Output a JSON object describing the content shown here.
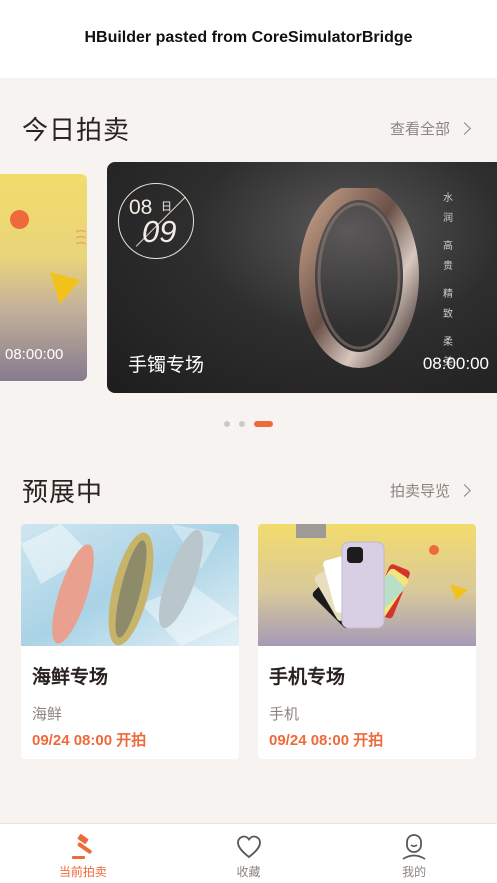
{
  "toast": {
    "text": "HBuilder pasted from CoreSimulatorBridge"
  },
  "today": {
    "title": "今日拍卖",
    "view_all": "查看全部",
    "peek_card": {
      "time": "08:00:00"
    },
    "main_card": {
      "month": "08",
      "day_char": "日",
      "day": "09",
      "name": "手镯专场",
      "time": "08:00:00",
      "tagline": [
        "水",
        "润",
        "高",
        "贵",
        "精",
        "致",
        "柔",
        "美"
      ]
    },
    "carousel": {
      "count": 3,
      "active_index": 2
    }
  },
  "preview": {
    "title": "预展中",
    "guide": "拍卖导览",
    "cards": [
      {
        "title": "海鲜专场",
        "category": "海鲜",
        "time": "09/24 08:00 开拍"
      },
      {
        "title": "手机专场",
        "category": "手机",
        "time": "09/24 08:00 开拍"
      }
    ]
  },
  "tabs": [
    {
      "label": "当前拍卖",
      "icon": "gavel-icon",
      "active": true
    },
    {
      "label": "收藏",
      "icon": "heart-icon",
      "active": false
    },
    {
      "label": "我的",
      "icon": "profile-icon",
      "active": false
    }
  ],
  "colors": {
    "accent": "#ef6a3a",
    "background": "#f6f3f1"
  }
}
